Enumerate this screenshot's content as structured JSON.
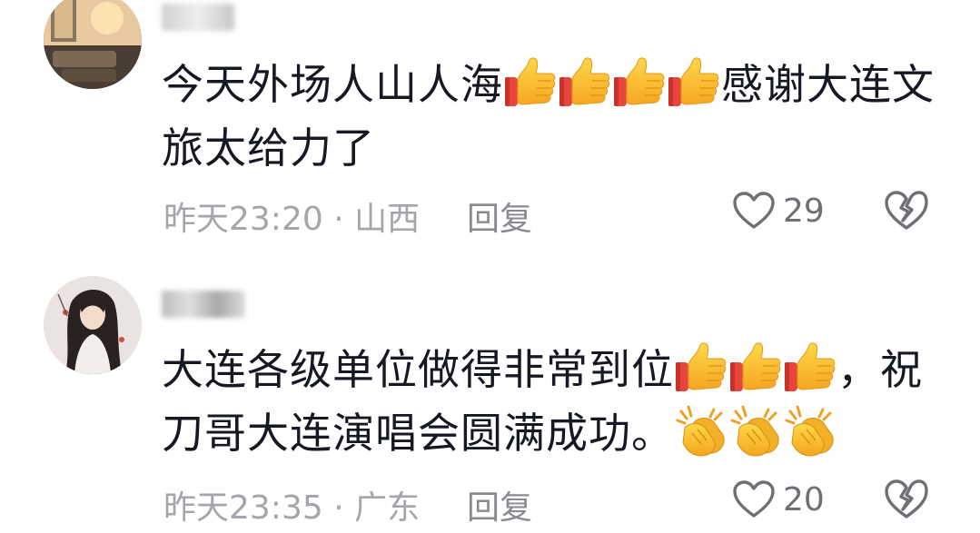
{
  "comments": [
    {
      "text_before": "今天外场人山人海",
      "emoji_mid": "thumbs-up",
      "emoji_mid_count": 4,
      "text_after": "感谢大连文旅太给力了",
      "time": "昨天23:20",
      "separator": "·",
      "location": "山西",
      "reply_label": "回复",
      "likes": "29"
    },
    {
      "text_before": "大连各级单位做得非常到位",
      "emoji_mid": "thumbs-up",
      "emoji_mid_count": 3,
      "text_after": "，祝刀哥大连演唱会圆满成功。",
      "emoji_end": "clapping-hands",
      "emoji_end_count": 3,
      "time": "昨天23:35",
      "separator": "·",
      "location": "广东",
      "reply_label": "回复",
      "likes": "20"
    }
  ],
  "icons": {
    "like": "heart-outline-icon",
    "dislike": "broken-heart-icon",
    "thumbs_up": "thumbs-up-emoji",
    "clap": "clapping-hands-emoji"
  },
  "colors": {
    "text": "#161823",
    "meta": "#a5a6ab",
    "icon": "#6f7076"
  }
}
